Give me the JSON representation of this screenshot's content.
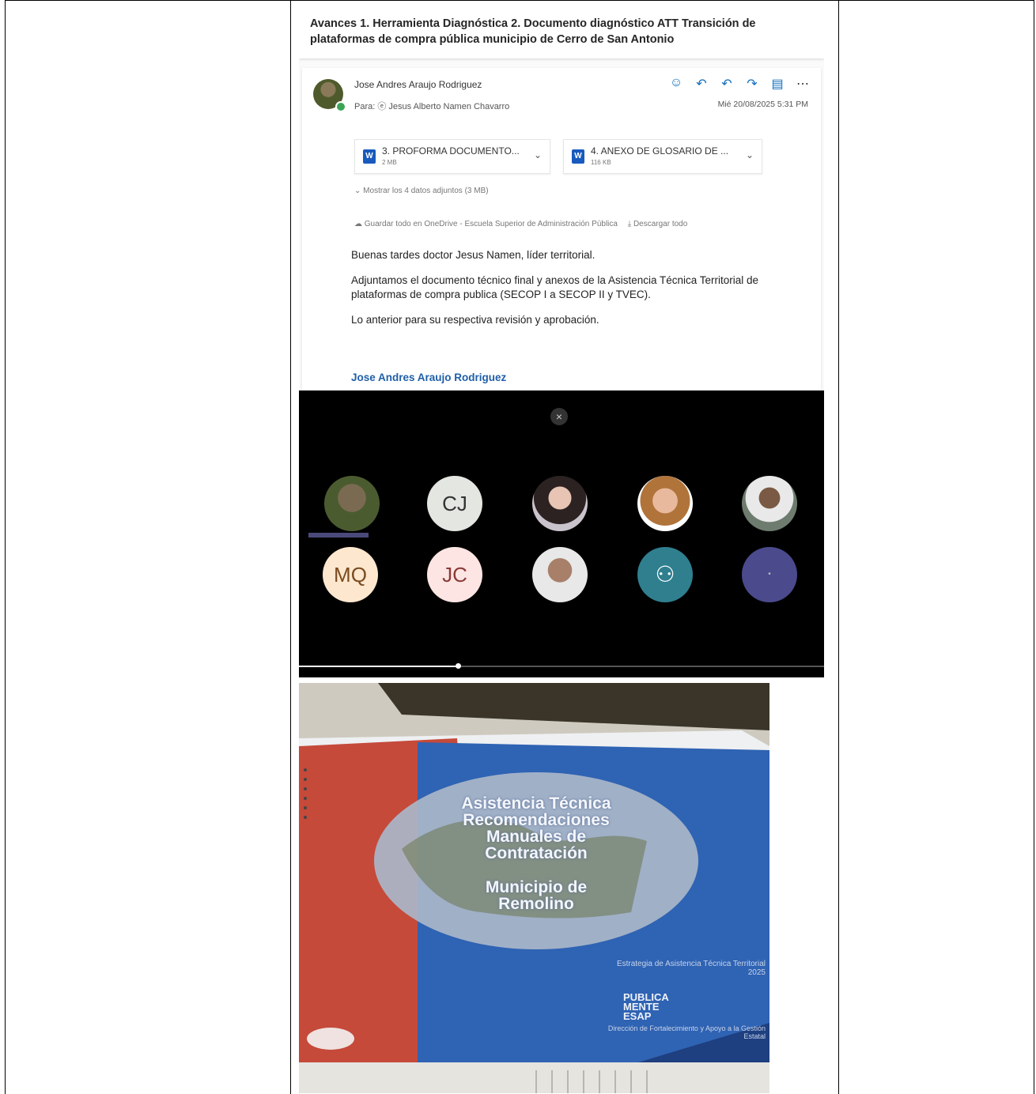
{
  "email": {
    "subject": "Avances 1. Herramienta Diagnóstica 2. Documento diagnóstico ATT Transición de plataformas de compra pública municipio de Cerro de San Antonio",
    "sender": "Jose Andres Araujo Rodriguez",
    "to": "Para: ⓔ Jesus Alberto Namen Chavarro",
    "date": "Mié 20/08/2025 5:31 PM",
    "attachments": [
      {
        "name": "3. PROFORMA DOCUMENTO...",
        "size": "2 MB"
      },
      {
        "name": "4. ANEXO DE GLOSARIO DE ...",
        "size": "116 KB"
      }
    ],
    "show_all": "Mostrar los 4 datos adjuntos (3 MB)",
    "save_all": "Guardar todo en OneDrive - Escuela Superior de Administración Pública",
    "download_all": "Descargar todo",
    "body": [
      "Buenas tardes doctor Jesus Namen, líder territorial.",
      "Adjuntamos el documento técnico final y anexos de la Asistencia Técnica Territorial de plataformas de compra publica (SECOP I a SECOP II y TVEC).",
      "Lo anterior para su respectiva revisión y aprobación."
    ],
    "signature": "Jose Andres Araujo Rodriguez"
  },
  "meeting": {
    "close_symbol": "×",
    "participants_row1": [
      "",
      "CJ",
      "",
      "",
      ""
    ],
    "participants_row2": [
      "MQ",
      "JC",
      "",
      "",
      ""
    ]
  },
  "photo": {
    "cover_lines": [
      "Asistencia Técnica",
      "Recomendaciones",
      "Manuales de",
      "Contratación",
      "Municipio de",
      "Remolino"
    ],
    "strategy": "Estrategia de Asistencia Técnica Territorial 2025",
    "logo": "PUBLICA MENTE ESAP",
    "footer": "Dirección de Fortalecimiento y Apoyo a la Gestión Estatal"
  }
}
